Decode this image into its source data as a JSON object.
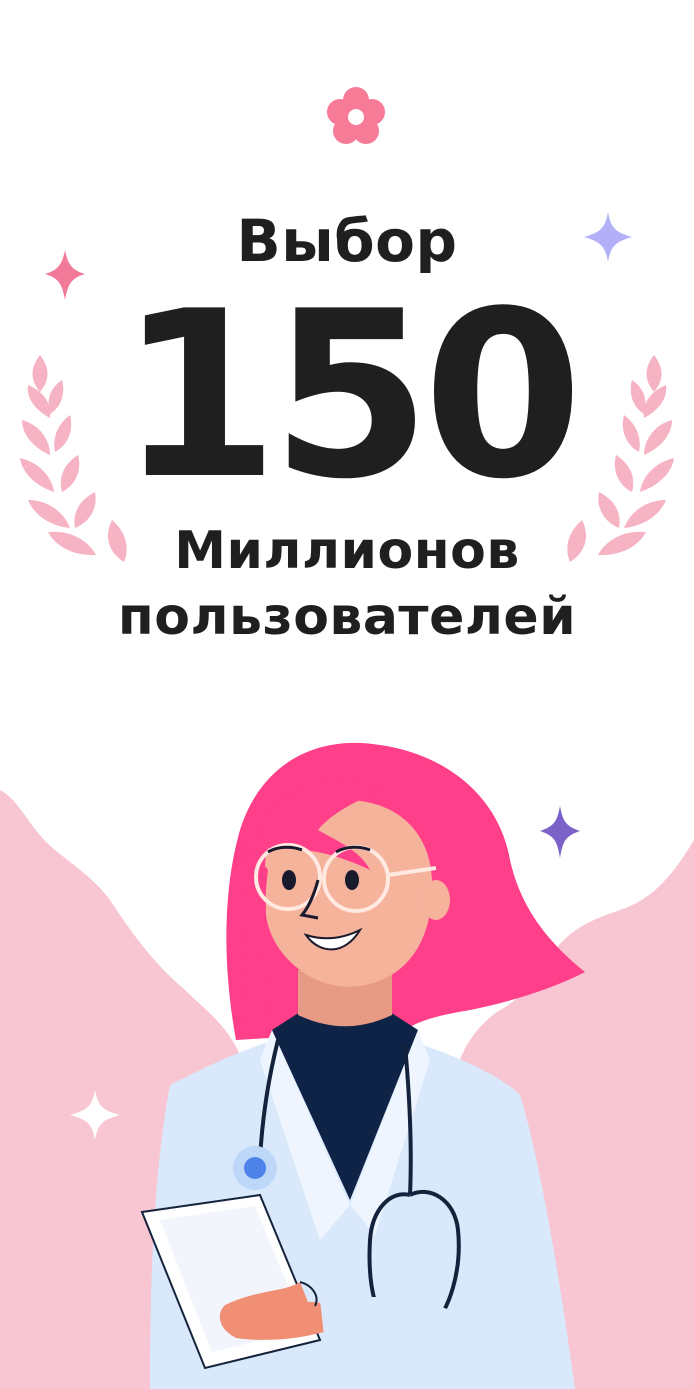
{
  "promo": {
    "choice_label": "Выбор",
    "user_count": "150",
    "units_line1": "Миллионов",
    "units_line2": "пользователей"
  },
  "colors": {
    "accent_pink": "#ff3f8a",
    "soft_pink": "#f7c6d2",
    "laurel_pink": "#f6b3c4",
    "coat_blue": "#d9e9fb",
    "skin": "#f6b39c",
    "shirt_navy": "#0f2346",
    "sparkle_lavender": "#b3b0f7",
    "sparkle_purple": "#7b62c9",
    "text_dark": "#1f1f1f"
  },
  "icons": [
    "flower-icon",
    "sparkle-icon",
    "laurel-icon",
    "stethoscope-icon",
    "badge-icon",
    "clipboard-icon"
  ]
}
